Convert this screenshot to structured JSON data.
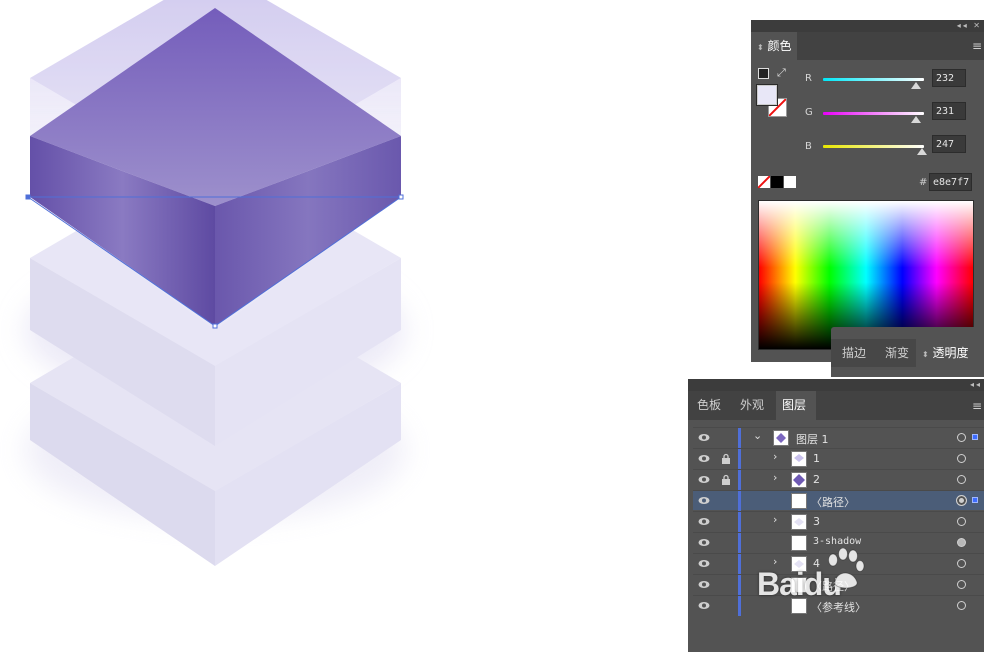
{
  "color_panel": {
    "tab_label": "颜色",
    "r_label": "R",
    "g_label": "G",
    "b_label": "B",
    "r_value": "232",
    "g_value": "231",
    "b_value": "247",
    "hex_label": "#",
    "hex_value": "e8e7f7"
  },
  "tabs_panel": {
    "tab_stroke": "描边",
    "tab_gradient": "渐变",
    "tab_transparency": "透明度"
  },
  "layers_panel": {
    "tab_swatches": "色板",
    "tab_appearance": "外观",
    "tab_layers": "图层",
    "rows": [
      {
        "name": "图层 1"
      },
      {
        "name": "1"
      },
      {
        "name": "2"
      },
      {
        "name": "〈路径〉"
      },
      {
        "name": "3"
      },
      {
        "name": "3-shadow"
      },
      {
        "name": "4"
      },
      {
        "name": "〈路径〉"
      },
      {
        "name": "〈参考线〉"
      }
    ]
  },
  "watermark": {
    "text": "Baidu"
  },
  "colors": {
    "fill": "#e8e7f7",
    "purple_top": "#7b66bf",
    "purple_left": "#6b55ae",
    "purple_right": "#7562b4",
    "selection": "#4f6fd8"
  }
}
